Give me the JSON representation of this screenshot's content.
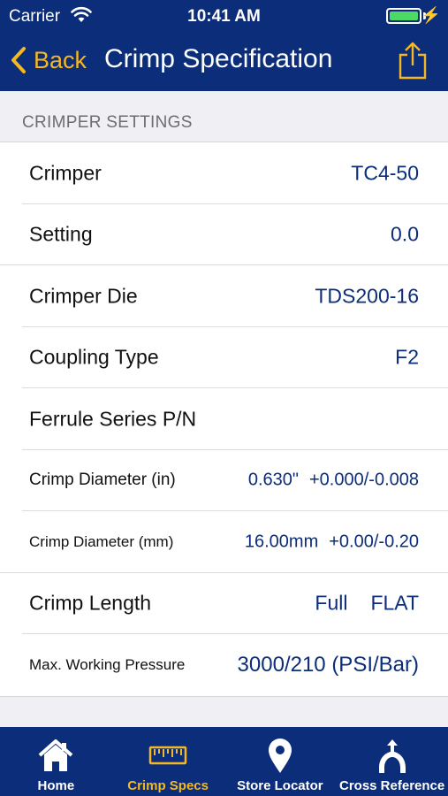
{
  "status": {
    "carrier": "Carrier",
    "time": "10:41 AM"
  },
  "nav": {
    "back_label": "Back",
    "title": "Crimp Specification"
  },
  "section": {
    "header": "CRIMPER SETTINGS"
  },
  "rows": [
    {
      "label": "Crimper",
      "value": "TC4-50"
    },
    {
      "label": "Setting",
      "value": "0.0"
    },
    {
      "label": "Crimper Die",
      "value": "TDS200-16"
    },
    {
      "label": "Coupling Type",
      "value": "F2"
    },
    {
      "label": "Ferrule Series P/N",
      "value": ""
    },
    {
      "label": "Crimp Diameter (in)",
      "value": "0.630\"",
      "value2": "+0.000/-0.008"
    },
    {
      "label": "Crimp Diameter (mm)",
      "value": "16.00mm",
      "value2": "+0.00/-0.20"
    },
    {
      "label": "Crimp Length",
      "value": "Full",
      "value2": "FLAT"
    },
    {
      "label": "Max. Working Pressure",
      "value": "3000/210 (PSI/Bar)"
    }
  ],
  "tabs": [
    {
      "label": "Home",
      "icon": "home-icon"
    },
    {
      "label": "Crimp Specs",
      "icon": "ruler-icon"
    },
    {
      "label": "Store Locator",
      "icon": "location-pin-icon"
    },
    {
      "label": "Cross Reference",
      "icon": "fork-icon"
    }
  ],
  "colors": {
    "nav": "#0b2d7a",
    "accent": "#f5b820",
    "value": "#0b2d7a",
    "battery": "#4cd964"
  }
}
